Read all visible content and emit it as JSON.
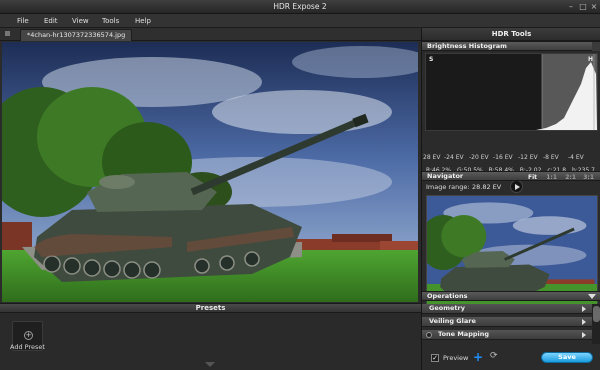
{
  "window": {
    "title": "HDR Expose 2"
  },
  "menu": [
    "File",
    "Edit",
    "View",
    "Tools",
    "Help"
  ],
  "tab": {
    "filename": "*4chan-hr1307372336574.jpg"
  },
  "presets": {
    "header": "Presets",
    "add_label": "Add Preset"
  },
  "tools": {
    "header": "HDR Tools",
    "histogram": {
      "title": "Brightness Histogram",
      "s_label": "S",
      "h_label": "H",
      "ev_ticks": [
        "28 EV",
        "-24 EV",
        "-20 EV",
        "-16 EV",
        "-12 EV",
        "-8 EV",
        "-4 EV"
      ],
      "r": "R:46.2%",
      "g": "G:50.5%",
      "b": "B:58.4%",
      "bv": "B:-2.02",
      "c": "c:21.8",
      "h": "h:235.7",
      "range_label": "Image range:",
      "range_value": "28.82 EV"
    },
    "navigator": {
      "title": "Navigator",
      "fit": "Fit",
      "zoom": [
        "1:1",
        "2:1",
        "3:1"
      ]
    },
    "operations": {
      "title": "Operations",
      "items": [
        "Geometry",
        "Veiling Glare",
        "Tone Mapping"
      ]
    },
    "preview_label": "Preview",
    "save_label": "Save"
  },
  "icons": {
    "minimize": "minimize-icon",
    "maximize": "maximize-icon",
    "close": "close-icon",
    "add": "plus-icon",
    "refresh": "refresh-icon",
    "play": "play-icon"
  },
  "colors": {
    "accent": "#1a9ddf",
    "add_icon": "#1e90ff"
  }
}
